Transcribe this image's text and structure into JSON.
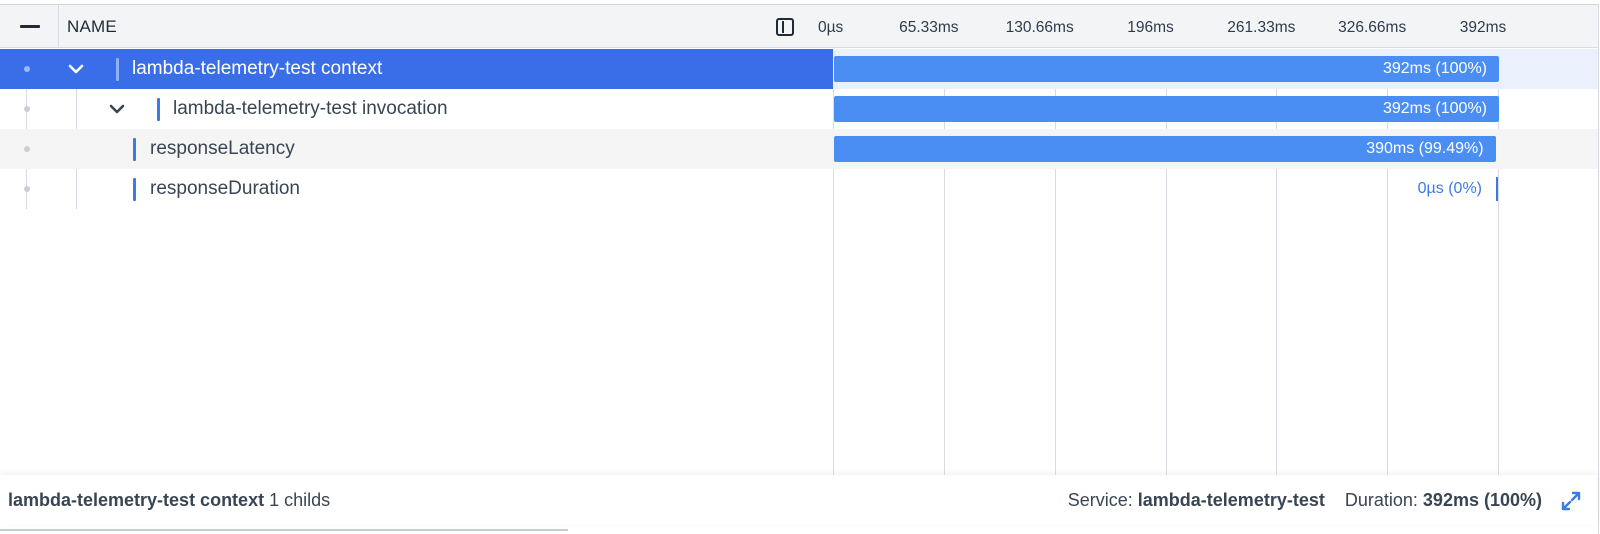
{
  "header": {
    "name_label": "NAME",
    "collapse_icon": "minus-icon",
    "panel_icon": "sidebar-toggle-icon",
    "ticks": [
      "0µs",
      "65.33ms",
      "130.66ms",
      "196ms",
      "261.33ms",
      "326.66ms",
      "392ms"
    ]
  },
  "spans": [
    {
      "name": "lambda-telemetry-test context",
      "bar_label": "392ms (100%)",
      "duration_ms": 392,
      "percent": 100,
      "expanded": true,
      "selected": true
    },
    {
      "name": "lambda-telemetry-test invocation",
      "bar_label": "392ms (100%)",
      "duration_ms": 392,
      "percent": 100,
      "expanded": true,
      "selected": false
    },
    {
      "name": "responseLatency",
      "bar_label": "390ms (99.49%)",
      "duration_ms": 390,
      "percent": 99.49,
      "selected": false
    },
    {
      "name": "responseDuration",
      "bar_label": "0µs (0%)",
      "duration_ms": 0,
      "percent": 0,
      "selected": false
    }
  ],
  "footer": {
    "selected_name": "lambda-telemetry-test context",
    "childs_text": "1 childs",
    "service_label": "Service:",
    "service_value": "lambda-telemetry-test",
    "duration_label": "Duration:",
    "duration_value": "392ms (100%)",
    "expand_icon": "expand-arrows-icon"
  },
  "colors": {
    "selected_row": "#3a6ee8",
    "bar": "#4a8ef3",
    "marker": "#3a7be6"
  }
}
